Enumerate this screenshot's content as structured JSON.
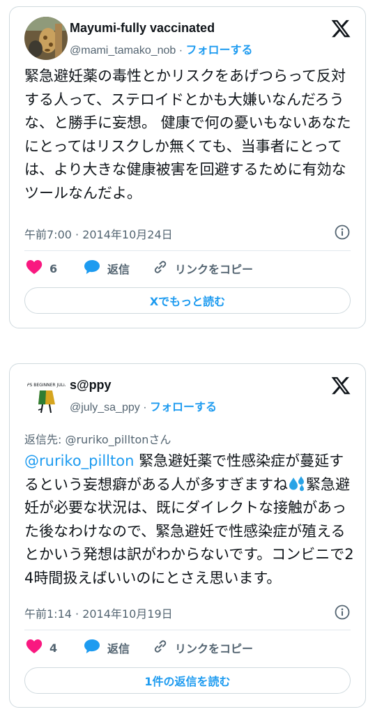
{
  "tweets": [
    {
      "name": "Mayumi-fully vaccinated",
      "handle": "@mami_tamako_nob",
      "separator": "·",
      "follow_label": "フォローする",
      "reply_to": "",
      "mention": "",
      "text": "緊急避妊薬の毒性とかリスクをあげつらって反対する人って、ステロイドとかも大嫌いなんだろうな、と勝手に妄想。 健康で何の憂いもないあなたにとってはリスクしか無くても、当事者にとっては、より大きな健康被害を回避するために有効なツールなんだよ。",
      "timestamp": "午前7:00 · 2014年10月24日",
      "like_count": "6",
      "reply_label": "返信",
      "copy_label": "リンクをコピー",
      "read_more_label": "Xでもっと読む"
    },
    {
      "name": "s@ppy",
      "handle": "@july_sa_ppy",
      "separator": "·",
      "follow_label": "フォローする",
      "reply_to": "返信先: @ruriko_pilltonさん",
      "mention": "@ruriko_pillton",
      "text_a": " 緊急避妊薬で性感染症が蔓延するという妄想癖がある人が多すぎますね",
      "text_b": "緊急避妊が必要な状況は、既にダイレクトな接触があった後なわけなので、緊急避妊で性感染症が殖えるとかいう発想は訳がわからないです。コンビニで24時間扱えばいいのにとさえ思います。",
      "emoji": "sweat-droplets-emoji",
      "timestamp": "午前1:14 · 2014年10月19日",
      "like_count": "4",
      "reply_label": "返信",
      "copy_label": "リンクをコピー",
      "read_more_label": "1件の返信を読む"
    }
  ],
  "colors": {
    "accent": "#1d9bf0",
    "heart": "#f91880",
    "muted": "#536471",
    "border": "#cfd9de"
  },
  "icons": [
    "x-logo-icon",
    "info-icon",
    "heart-icon",
    "speech-bubble-icon",
    "link-icon"
  ]
}
